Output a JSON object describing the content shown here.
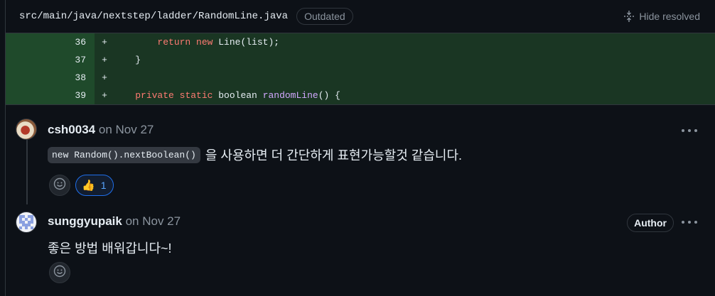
{
  "file": {
    "path": "src/main/java/nextstep/ladder/RandomLine.java",
    "status_badge": "Outdated",
    "hide_resolved_label": "Hide resolved"
  },
  "code_lines": [
    {
      "number": "36",
      "marker": "+",
      "text": "return new Line(list);"
    },
    {
      "number": "37",
      "marker": "+",
      "text": "}"
    },
    {
      "number": "38",
      "marker": "+",
      "text": ""
    },
    {
      "number": "39",
      "marker": "+",
      "text": "private static boolean randomLine() {"
    }
  ],
  "comments": [
    {
      "author": "csh0034",
      "date": "on Nov 27",
      "inline_code": "new Random().nextBoolean()",
      "text": "을 사용하면 더 간단하게 표현가능할것 같습니다.",
      "reaction": {
        "emoji": "👍",
        "count": "1"
      }
    },
    {
      "author": "sunggyupaik",
      "date": "on Nov 27",
      "badge": "Author",
      "text": "좋은 방법 배워갑니다~!"
    }
  ],
  "colors": {
    "background": "#0d1117",
    "added_line_bg": "#1a3623",
    "accent": "#58a6ff",
    "keyword": "#ff7b72",
    "function": "#d2a8ff"
  }
}
